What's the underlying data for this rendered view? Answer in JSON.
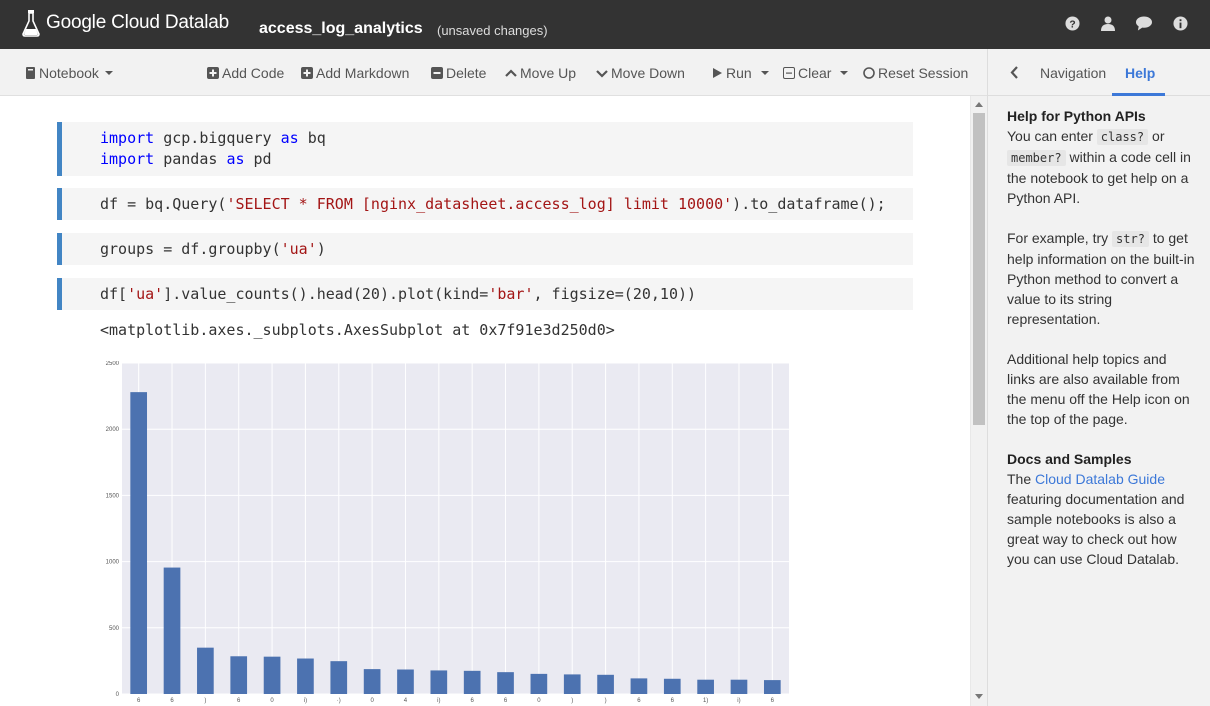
{
  "header": {
    "brand": "Google Cloud Datalab",
    "notebook_title": "access_log_analytics",
    "status": "(unsaved changes)",
    "icons": [
      "help-icon",
      "user-icon",
      "chat-icon",
      "info-icon"
    ]
  },
  "toolbar": {
    "notebook_menu": "Notebook",
    "add_code": "Add Code",
    "add_markdown": "Add Markdown",
    "delete": "Delete",
    "move_up": "Move Up",
    "move_down": "Move Down",
    "run": "Run",
    "clear": "Clear",
    "reset_session": "Reset Session"
  },
  "cells": [
    {
      "line1_kw1": "import",
      "line1_rest": " gcp.bigquery ",
      "line1_kw2": "as",
      "line1_end": " bq",
      "line2_kw1": "import",
      "line2_rest": " pandas ",
      "line2_kw2": "as",
      "line2_end": " pd"
    },
    {
      "pre": "df = bq.Query(",
      "str": "'SELECT * FROM [nginx_datasheet.access_log] limit 10000'",
      "post": ").to_dataframe();"
    },
    {
      "pre": "groups = df.groupby(",
      "str": "'ua'",
      "post": ")"
    },
    {
      "pre": "df[",
      "str1": "'ua'",
      "mid": "].value_counts().head(20).plot(kind=",
      "str2": "'bar'",
      "post": ", figsize=(20,10))"
    }
  ],
  "output_text": "<matplotlib.axes._subplots.AxesSubplot at 0x7f91e3d250d0>",
  "side_panel": {
    "tab_navigation": "Navigation",
    "tab_help": "Help",
    "help_heading": "Help for Python APIs",
    "help_p1_a": "You can enter ",
    "help_p1_code1": "class?",
    "help_p1_b": " or ",
    "help_p1_code2": "member?",
    "help_p1_c": " within a code cell in the notebook to get help on a Python API.",
    "help_p2_a": "For example, try ",
    "help_p2_code": "str?",
    "help_p2_b": " to get help information on the built-in Python method to convert a value to its string representation.",
    "help_p3": "Additional help topics and links are also available from the menu off the Help icon on the top of the page.",
    "docs_heading": "Docs and Samples",
    "docs_a": "The ",
    "docs_link": "Cloud Datalab Guide",
    "docs_b": " featuring documentation and sample notebooks is also a great way to check out how you can use Cloud Datalab."
  },
  "chart_data": {
    "type": "bar",
    "ylim": [
      0,
      2500
    ],
    "yticks": [
      0,
      500,
      1000,
      1500,
      2000,
      2500
    ],
    "tick_labels_partial": [
      "6",
      "6",
      ")",
      "6",
      "0",
      "i)",
      "·)",
      "0",
      "4",
      "i)",
      "6",
      "6",
      "0",
      ")",
      ")",
      "6",
      "6",
      "1)",
      "i)",
      "6"
    ],
    "values": [
      2280,
      955,
      350,
      285,
      282,
      268,
      248,
      188,
      185,
      178,
      175,
      165,
      152,
      148,
      145,
      118,
      115,
      108,
      108,
      105
    ],
    "color": "#4c72b0",
    "background": "#eaeaf2",
    "grid": true
  }
}
